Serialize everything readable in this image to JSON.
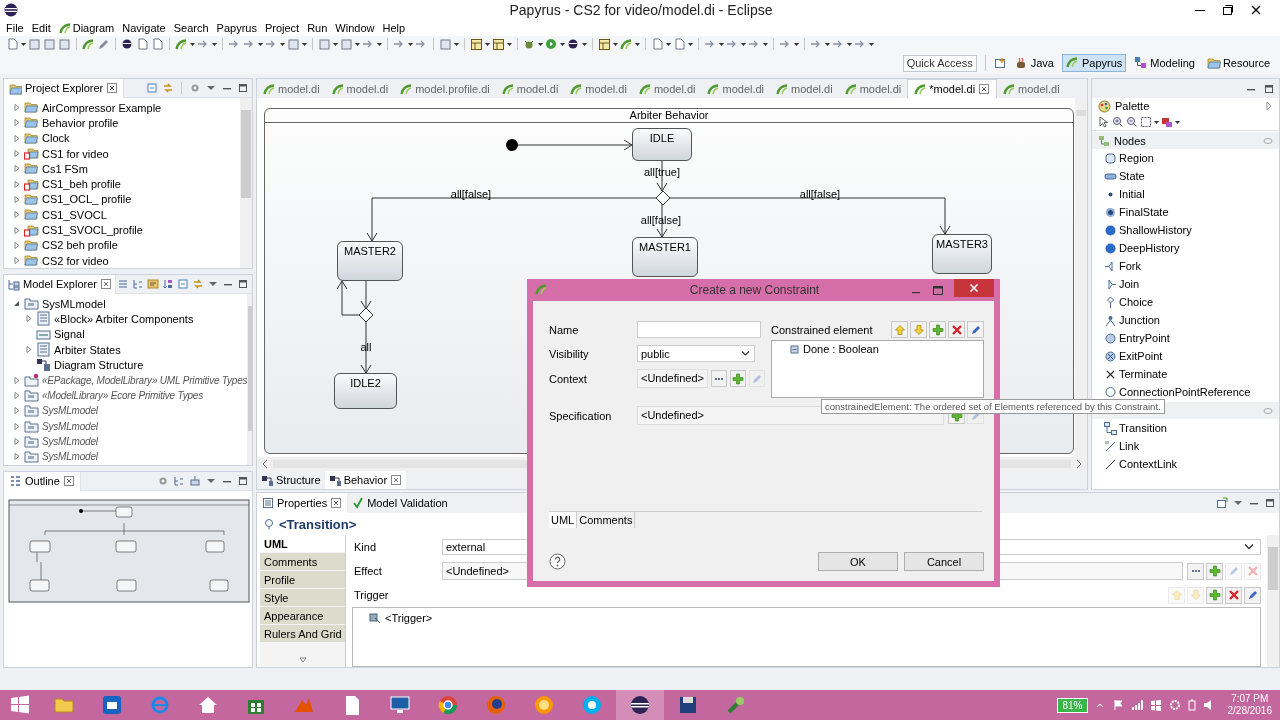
{
  "window": {
    "title": "Papyrus - CS2 for video/model.di - Eclipse"
  },
  "menu": [
    {
      "label": "File",
      "icon": false
    },
    {
      "label": "Edit",
      "icon": false
    },
    {
      "label": "Diagram",
      "icon": true
    },
    {
      "label": "Navigate",
      "icon": false
    },
    {
      "label": "Search",
      "icon": false
    },
    {
      "label": "Papyrus",
      "icon": false
    },
    {
      "label": "Project",
      "icon": false
    },
    {
      "label": "Run",
      "icon": false
    },
    {
      "label": "Window",
      "icon": false
    },
    {
      "label": "Help",
      "icon": false
    }
  ],
  "quick_access": {
    "placeholder": "Quick Access"
  },
  "perspectives": [
    {
      "label": "Java",
      "selected": false
    },
    {
      "label": "Papyrus",
      "selected": true
    },
    {
      "label": "Modeling",
      "selected": false
    },
    {
      "label": "Resource",
      "selected": false
    }
  ],
  "project_explorer": {
    "title": "Project Explorer",
    "items": [
      {
        "label": "AirCompressor Example",
        "kind": "folder",
        "expanded": false
      },
      {
        "label": "Behavior profile",
        "kind": "folder",
        "expanded": false
      },
      {
        "label": "Clock",
        "kind": "folder",
        "expanded": false
      },
      {
        "label": "CS1 for video",
        "kind": "papyrus",
        "expanded": false
      },
      {
        "label": "Cs1 FSm",
        "kind": "folder",
        "expanded": false
      },
      {
        "label": "CS1_beh profile",
        "kind": "papyrus",
        "expanded": false
      },
      {
        "label": "CS1_OCL_ profile",
        "kind": "folder",
        "expanded": false
      },
      {
        "label": "CS1_SVOCL",
        "kind": "folder",
        "expanded": false
      },
      {
        "label": "CS1_SVOCL_profile",
        "kind": "papyrus",
        "expanded": false
      },
      {
        "label": "CS2 beh profile",
        "kind": "folder",
        "expanded": false
      },
      {
        "label": "CS2 for video",
        "kind": "folder",
        "expanded": false
      }
    ]
  },
  "model_explorer": {
    "title": "Model Explorer",
    "items": [
      {
        "label": "SysMLmodel",
        "kind": "package",
        "imported": false,
        "expanded": true,
        "children": [
          {
            "label": "«Block» Arbiter Components",
            "kind": "block",
            "imported": false,
            "expanded": false
          },
          {
            "label": "Signal",
            "kind": "signal",
            "imported": false
          },
          {
            "label": "Arbiter States",
            "kind": "block",
            "imported": false,
            "expanded": false
          },
          {
            "label": "Diagram Structure",
            "kind": "diagram",
            "imported": false
          }
        ]
      },
      {
        "label": "«EPackage, ModelLibrary» UML Primitive Types",
        "kind": "library",
        "imported": true,
        "expanded": false
      },
      {
        "label": "«ModelLibrary» Ecore Primitive Types",
        "kind": "package",
        "imported": true,
        "expanded": false
      },
      {
        "label": "SysMLmodel",
        "kind": "package",
        "imported": true,
        "expanded": false
      },
      {
        "label": "SysMLmodel",
        "kind": "package",
        "imported": true,
        "expanded": false
      },
      {
        "label": "SysMLmodel",
        "kind": "package",
        "imported": true,
        "expanded": false
      },
      {
        "label": "SysMLmodel",
        "kind": "package",
        "imported": true,
        "expanded": false
      }
    ]
  },
  "outline": {
    "title": "Outline"
  },
  "editor_tabs": [
    {
      "label": "model.di",
      "selected": false
    },
    {
      "label": "model.di",
      "selected": false
    },
    {
      "label": "model.profile.di",
      "selected": false
    },
    {
      "label": "model.di",
      "selected": false
    },
    {
      "label": "model.di",
      "selected": false
    },
    {
      "label": "model.di",
      "selected": false
    },
    {
      "label": "model.di",
      "selected": false
    },
    {
      "label": "model.di",
      "selected": false
    },
    {
      "label": "model.di",
      "selected": false
    },
    {
      "label": "*model.di",
      "selected": true
    },
    {
      "label": "model.di",
      "selected": false
    }
  ],
  "diagram": {
    "title": "Arbiter Behavior",
    "states": [
      {
        "name": "IDLE"
      },
      {
        "name": "MASTER2"
      },
      {
        "name": "MASTER1"
      },
      {
        "name": "MASTER3"
      },
      {
        "name": "IDLE2"
      }
    ],
    "transitions": [
      {
        "label": "all[true]"
      },
      {
        "label": "all[false]"
      },
      {
        "label": "all[false]"
      },
      {
        "label": "all[false]"
      },
      {
        "label": "all"
      }
    ]
  },
  "diagram_tabs": [
    {
      "label": "Structure",
      "selected": false
    },
    {
      "label": "Behavior",
      "selected": true
    }
  ],
  "palette": {
    "title": "Palette",
    "drawers": [
      {
        "label": "Nodes",
        "items": [
          "Region",
          "State",
          "Initial",
          "FinalState",
          "ShallowHistory",
          "DeepHistory",
          "Fork",
          "Join",
          "Choice",
          "Junction",
          "EntryPoint",
          "ExitPoint",
          "Terminate",
          "ConnectionPointReference"
        ]
      },
      {
        "items": [
          "Transition",
          "Link",
          "ContextLink"
        ]
      }
    ]
  },
  "properties": {
    "tabs": [
      {
        "label": "Properties",
        "selected": true
      },
      {
        "label": "Model Validation",
        "selected": false
      }
    ],
    "heading": "<Transition>",
    "sections": [
      {
        "label": "UML",
        "selected": true
      },
      {
        "label": "Comments",
        "selected": false
      },
      {
        "label": "Profile",
        "selected": false
      },
      {
        "label": "Style",
        "selected": false
      },
      {
        "label": "Appearance",
        "selected": false
      },
      {
        "label": "Rulers And Grid",
        "selected": false
      }
    ],
    "kind": {
      "label": "Kind",
      "value": "external"
    },
    "effect": {
      "label": "Effect",
      "value": "<Undefined>"
    },
    "trigger": {
      "label": "Trigger",
      "items": [
        "<Trigger>"
      ]
    }
  },
  "dialog": {
    "title": "Create a new Constraint",
    "name": {
      "label": "Name"
    },
    "visibility": {
      "label": "Visibility",
      "value": "public"
    },
    "context": {
      "label": "Context",
      "value": "<Undefined>"
    },
    "constrained_element": {
      "label": "Constrained element",
      "items": [
        "Done : Boolean"
      ]
    },
    "specification": {
      "label": "Specification",
      "value": "<Undefined>"
    },
    "tabs": [
      {
        "label": "UML",
        "selected": true
      },
      {
        "label": "Comments",
        "selected": false
      }
    ],
    "buttons": [
      "OK",
      "Cancel"
    ]
  },
  "tooltip": "constrainedElement: The ordered set of Elements referenced by this Constraint.",
  "taskbar": {
    "battery": "81%",
    "time": "7:07 PM",
    "date": "2/28/2016"
  }
}
